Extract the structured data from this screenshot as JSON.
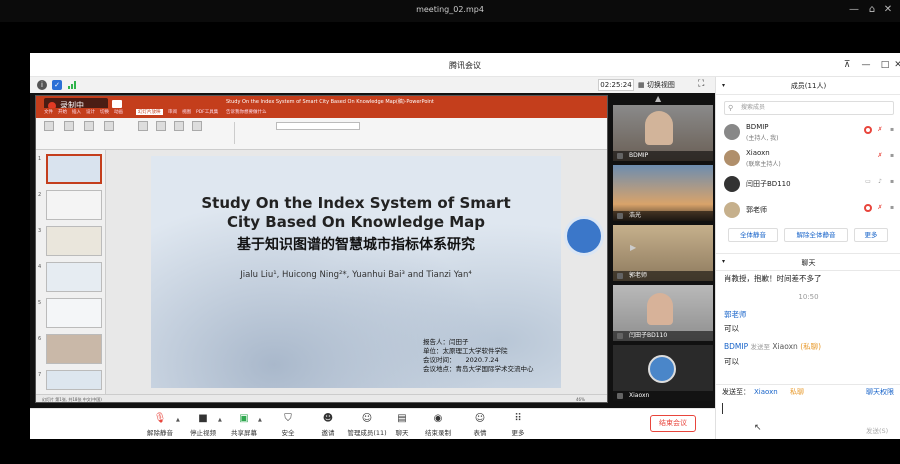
{
  "player": {
    "title": "meeting_02.mp4"
  },
  "window": {
    "title": "腾讯会议",
    "timer": "02:25:24",
    "switch_view": "切换视图"
  },
  "ppt": {
    "record_badge": "录制中",
    "doc_title": "Study On the Index System of Smart City Based On Knowledge Map(稿)·PowerPoint",
    "tabs": [
      "文件",
      "开始",
      "插入",
      "设计",
      "切换",
      "动画",
      "幻灯片放映",
      "审阅",
      "视图",
      "PDF工具集",
      "告诉我你想要做什么"
    ],
    "status": "幻灯片 第1张, 共18张   中文(中国)",
    "zoom": "46%"
  },
  "slide": {
    "title_en_1": "Study On the Index System of Smart",
    "title_en_2": "City Based On Knowledge Map",
    "title_cn": "基于知识图谱的智慧城市指标体系研究",
    "authors": "Jialu Liu¹,   Huicong Ning²*,  Yuanhui Bai³ and Tianzi Yan⁴",
    "reporter": "报告人：闫田子",
    "unit": "单位：太原理工大学软件学院",
    "meeting_time_label": "会议时间：",
    "meeting_time": "2020.7.24",
    "meeting_place": "会议地点：青岛大学国际学术交流中心"
  },
  "thumb_numbers": [
    "1",
    "2",
    "3",
    "4",
    "5",
    "6",
    "7"
  ],
  "tiles": [
    {
      "name": "BDMIP"
    },
    {
      "name": "浩光"
    },
    {
      "name": "郭老师"
    },
    {
      "name": "闫田子BD110"
    },
    {
      "name": "Xiaoxn"
    }
  ],
  "members_panel": {
    "title": "成员(11人)",
    "search_placeholder": "搜索成员",
    "members": [
      {
        "name": "BDMIP",
        "role": "(主持人, 我)"
      },
      {
        "name": "Xiaoxn",
        "role": "(联席主持人)"
      },
      {
        "name": "闫田子BD110",
        "role": ""
      },
      {
        "name": "郭老师",
        "role": ""
      }
    ],
    "mute_all": "全体静音",
    "unmute_all": "解除全体静音",
    "more": "更多"
  },
  "chat": {
    "title": "聊天",
    "messages": [
      {
        "sender": "",
        "text": "肖教授，抱歉！时间差不多了"
      },
      {
        "time": "10:50"
      },
      {
        "sender": "郭老师",
        "text": "可以"
      },
      {
        "sender": "BDMIP",
        "to_label": "发送至",
        "to": "Xiaoxn",
        "private": "(私聊)",
        "text": "可以"
      }
    ],
    "send_to_label": "发送至：",
    "send_to": "Xiaoxn",
    "private": "私聊",
    "chat_permission": "聊天权限",
    "send_button": "发送(S)"
  },
  "toolbar": {
    "items": [
      {
        "label": "解除静音",
        "icon": "mic-muted-icon"
      },
      {
        "label": "停止视频",
        "icon": "video-icon"
      },
      {
        "label": "共享屏幕",
        "icon": "share-screen-icon"
      },
      {
        "label": "安全",
        "icon": "shield-icon"
      },
      {
        "label": "邀请",
        "icon": "invite-icon"
      },
      {
        "label": "管理成员(11)",
        "icon": "members-icon"
      },
      {
        "label": "聊天",
        "icon": "chat-icon"
      },
      {
        "label": "结束录制",
        "icon": "record-icon"
      },
      {
        "label": "表情",
        "icon": "emoji-icon"
      },
      {
        "label": "更多",
        "icon": "more-icon"
      }
    ],
    "end_meeting": "结束会议"
  },
  "colors": {
    "accent": "#1763c9",
    "danger": "#e8453c",
    "ppt": "#c43e1c"
  }
}
